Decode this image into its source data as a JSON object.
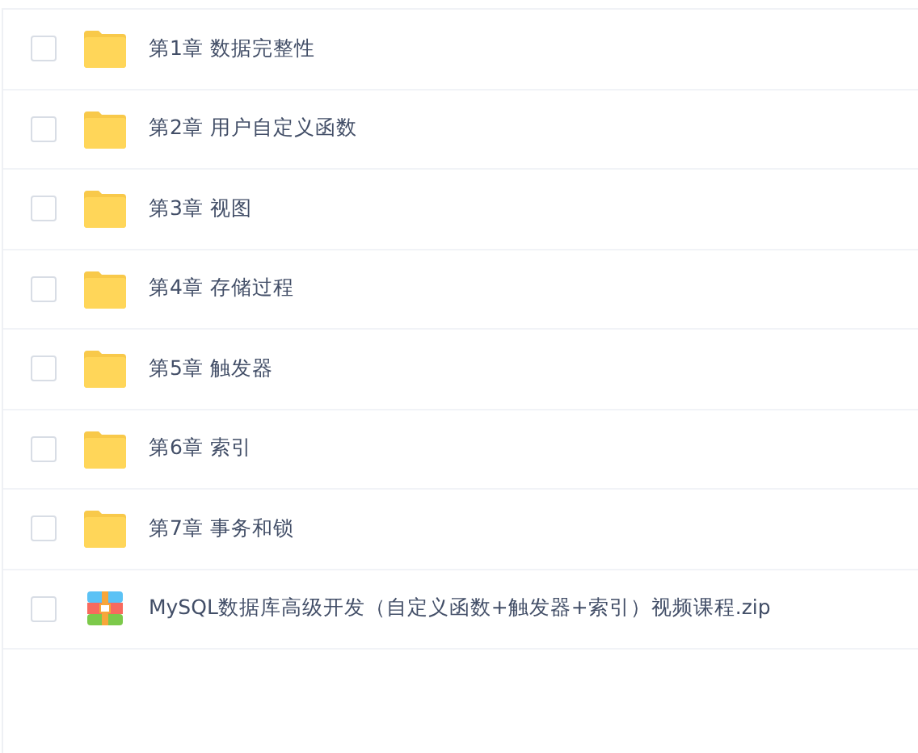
{
  "files": [
    {
      "name": "第1章 数据完整性",
      "kind": "folder",
      "checked": false
    },
    {
      "name": "第2章 用户自定义函数",
      "kind": "folder",
      "checked": false
    },
    {
      "name": "第3章 视图",
      "kind": "folder",
      "checked": false
    },
    {
      "name": "第4章 存储过程",
      "kind": "folder",
      "checked": false
    },
    {
      "name": "第5章 触发器",
      "kind": "folder",
      "checked": false
    },
    {
      "name": "第6章 索引",
      "kind": "folder",
      "checked": false
    },
    {
      "name": "第7章 事务和锁",
      "kind": "folder",
      "checked": false
    },
    {
      "name": "MySQL数据库高级开发（自定义函数+触发器+索引）视频课程.zip",
      "kind": "zip",
      "checked": false
    }
  ]
}
